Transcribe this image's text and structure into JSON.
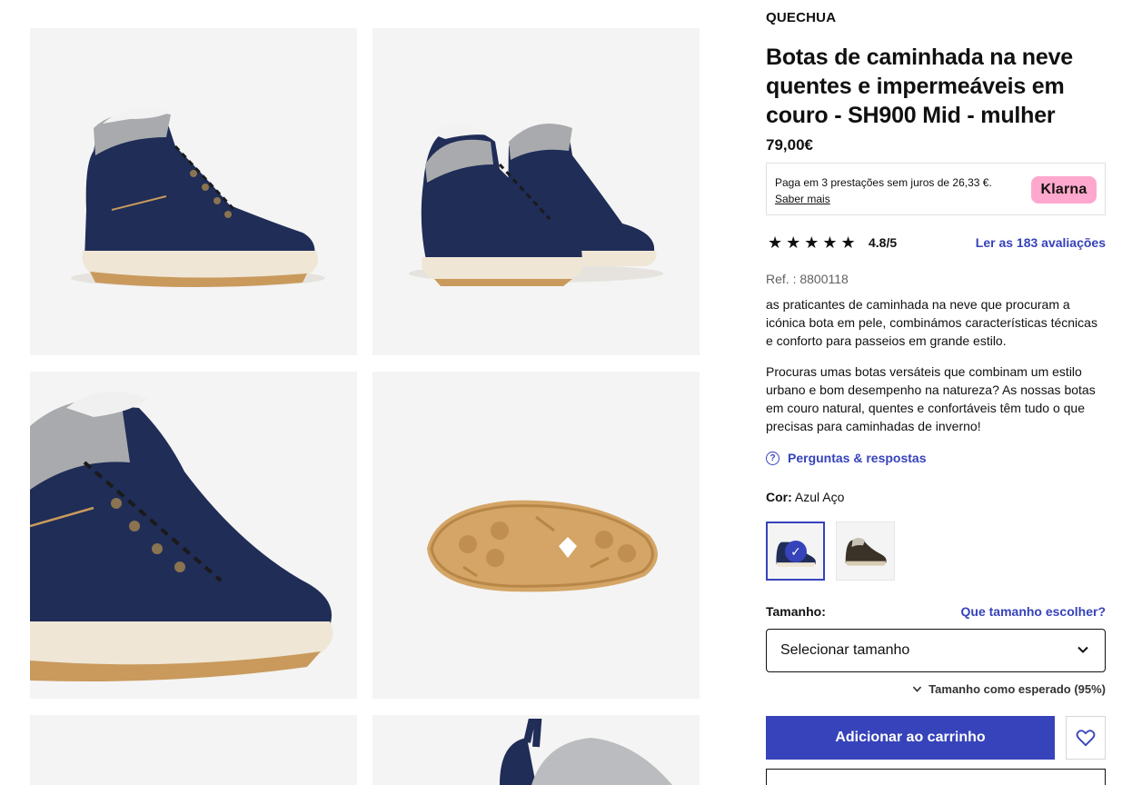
{
  "product": {
    "brand": "QUECHUA",
    "title": "Botas de caminhada na neve quentes e impermeáveis em couro - SH900 Mid - mulher",
    "price": "79,00€",
    "klarna": {
      "text": "Paga em 3 prestações sem juros de 26,33 €.",
      "link": "Saber mais",
      "badge": "Klarna"
    },
    "rating": {
      "stars": "★★★★★",
      "value": "4.8/5",
      "reviews_link": "Ler as 183 avaliações"
    },
    "ref": "Ref. : 8800118",
    "description_1": "as praticantes de caminhada na neve que procuram a icónica bota em pele, combinámos características técnicas e conforto para passeios em grande estilo.",
    "description_2": "Procuras umas botas versáteis que combinam um estilo urbano e bom desempenho na natureza? As nossas botas em couro natural, quentes e confortáveis têm tudo o que precisas para caminhadas de inverno!",
    "qa_link": "Perguntas & respostas",
    "qa_icon": "?",
    "color_label": "Cor:",
    "color_value": "Azul Aço",
    "size_label": "Tamanho:",
    "size_guide_link": "Que tamanho escolher?",
    "size_select_placeholder": "Selecionar tamanho",
    "fit_note": "Tamanho como esperado (95%)",
    "add_to_cart": "Adicionar ao carrinho",
    "check_mark": "✓"
  },
  "colors": {
    "accent": "#3643ba",
    "navy_boot": "#1e2d57",
    "brown_boot": "#3a3226",
    "sole_cream": "#efe6d6",
    "sole_tan": "#c99a5c",
    "klarna_pink": "#ffa8cd"
  },
  "icons": [
    "check-icon",
    "question-circle-icon",
    "chevron-down-icon",
    "heart-icon",
    "star-icon"
  ]
}
